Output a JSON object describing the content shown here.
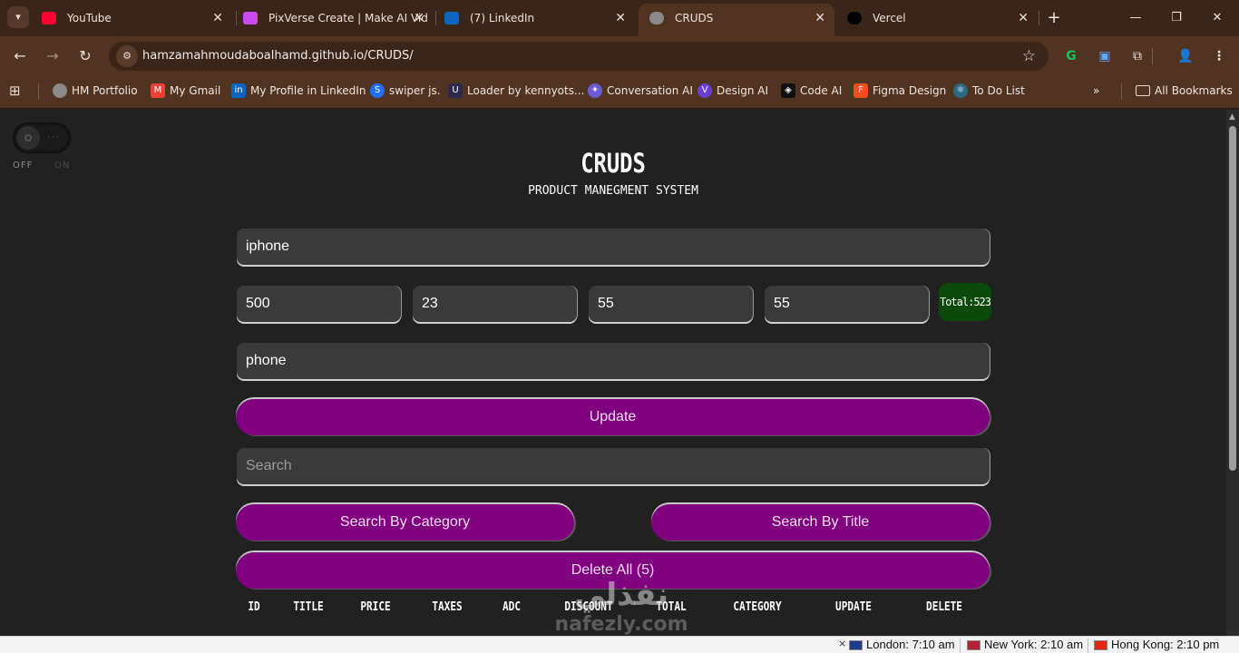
{
  "browser": {
    "tabs": [
      {
        "title": "YouTube",
        "icon": "youtube-icon",
        "color": "#ff0033"
      },
      {
        "title": "PixVerse Create | Make AI Vid",
        "icon": "pixverse-icon",
        "color": "#c94af0"
      },
      {
        "title": "(7) LinkedIn",
        "icon": "linkedin-icon",
        "color": "#0a66c2"
      },
      {
        "title": "CRUDS",
        "icon": "globe-icon",
        "color": "#8a8a8a",
        "active": true
      },
      {
        "title": "Vercel",
        "icon": "vercel-icon",
        "color": "#000000"
      }
    ],
    "url": "hamzamahmoudaboalhamd.github.io/CRUDS/",
    "bookmarks": [
      {
        "label": "HM Portfolio",
        "icon": "globe-icon"
      },
      {
        "label": "My Gmail",
        "icon": "gmail-icon"
      },
      {
        "label": "My Profile in LinkedIn",
        "icon": "linkedin-icon"
      },
      {
        "label": "swiper js.",
        "icon": "swiper-icon"
      },
      {
        "label": "Loader by kennyots...",
        "icon": "uiverse-icon"
      },
      {
        "label": "Conversation AI",
        "icon": "ai-icon"
      },
      {
        "label": "Design AI",
        "icon": "design-ai-icon"
      },
      {
        "label": "Code AI",
        "icon": "code-ai-icon"
      },
      {
        "label": "Figma Design",
        "icon": "figma-icon"
      },
      {
        "label": "To Do List",
        "icon": "react-icon"
      }
    ],
    "all_bookmarks": "All Bookmarks"
  },
  "app": {
    "toggle": {
      "off": "OFF",
      "on": "ON"
    },
    "title": "CRUDS",
    "subtitle": "PRODUCT MANEGMENT SYSTEM",
    "form": {
      "title": "iphone",
      "price": "500",
      "taxes": "23",
      "ads": "55",
      "discount": "55",
      "total": "Total:523",
      "category": "phone"
    },
    "update_button": "Update",
    "search_placeholder": "Search",
    "search_by_category": "Search By Category",
    "search_by_title": "Search By Title",
    "delete_all": "Delete All (5)",
    "table_headers": [
      "ID",
      "TITLE",
      "PRICE",
      "TAXES",
      "ADC",
      "DISCOUNT",
      "TOTAL",
      "CATEGORY",
      "UPDATE",
      "DELETE"
    ],
    "colors": {
      "accent": "#800080",
      "total_bg": "#0b4a0b",
      "background": "#212121"
    }
  },
  "watermark": {
    "arabic": "نفذلي",
    "latin": "nafezly.com"
  },
  "statusbar": {
    "clocks": [
      {
        "label": "London: 7:10 am"
      },
      {
        "label": "New York: 2:10 am"
      },
      {
        "label": "Hong Kong: 2:10 pm"
      }
    ]
  }
}
